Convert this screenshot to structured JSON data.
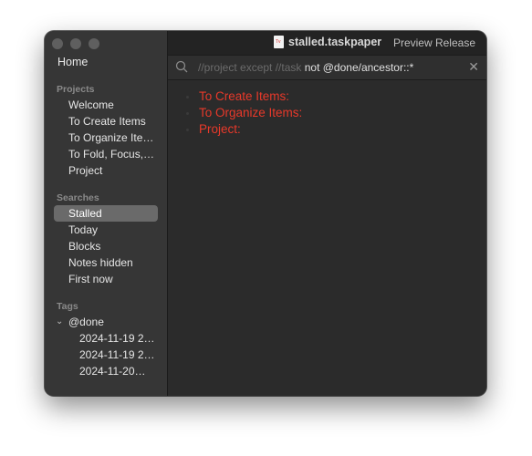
{
  "window": {
    "title": "stalled.taskpaper",
    "file_icon": "taskpaper-file-icon",
    "preview_label": "Preview Release"
  },
  "sidebar": {
    "home": "Home",
    "projects_header": "Projects",
    "projects": [
      "Welcome",
      "To Create Items",
      "To Organize Ite…",
      "To Fold, Focus,…",
      "Project"
    ],
    "searches_header": "Searches",
    "searches": [
      "Stalled",
      "Today",
      "Blocks",
      "Notes hidden",
      "First now"
    ],
    "selected_search": "Stalled",
    "tags_header": "Tags",
    "tag": "@done",
    "tag_children": [
      "2024-11-19 2…",
      "2024-11-19 2…",
      "2024-11-20…"
    ]
  },
  "search": {
    "query_dim": "//project except //task",
    "query_bright": " not @done/ancestor::*",
    "icon": "search-icon",
    "clear_icon": "close-icon"
  },
  "outline": {
    "items": [
      "To Create Items:",
      "To Organize Items:",
      "Project:"
    ],
    "color": "#e8392a"
  }
}
